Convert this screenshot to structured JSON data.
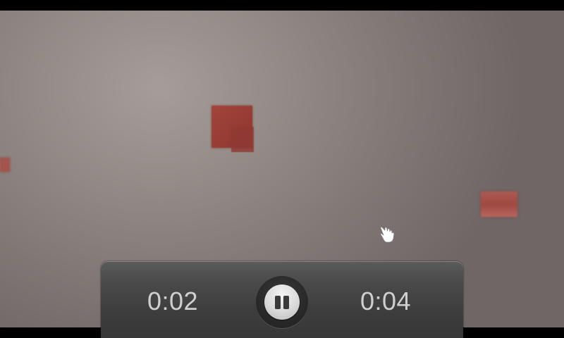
{
  "player": {
    "elapsed_time": "0:02",
    "total_time": "0:04",
    "state": "playing",
    "pause_icon": "pause-icon"
  },
  "scene": {
    "background_color": "#a59d99",
    "cube_color": "#9c4038",
    "cursor_icon": "hand-pointer-icon"
  }
}
